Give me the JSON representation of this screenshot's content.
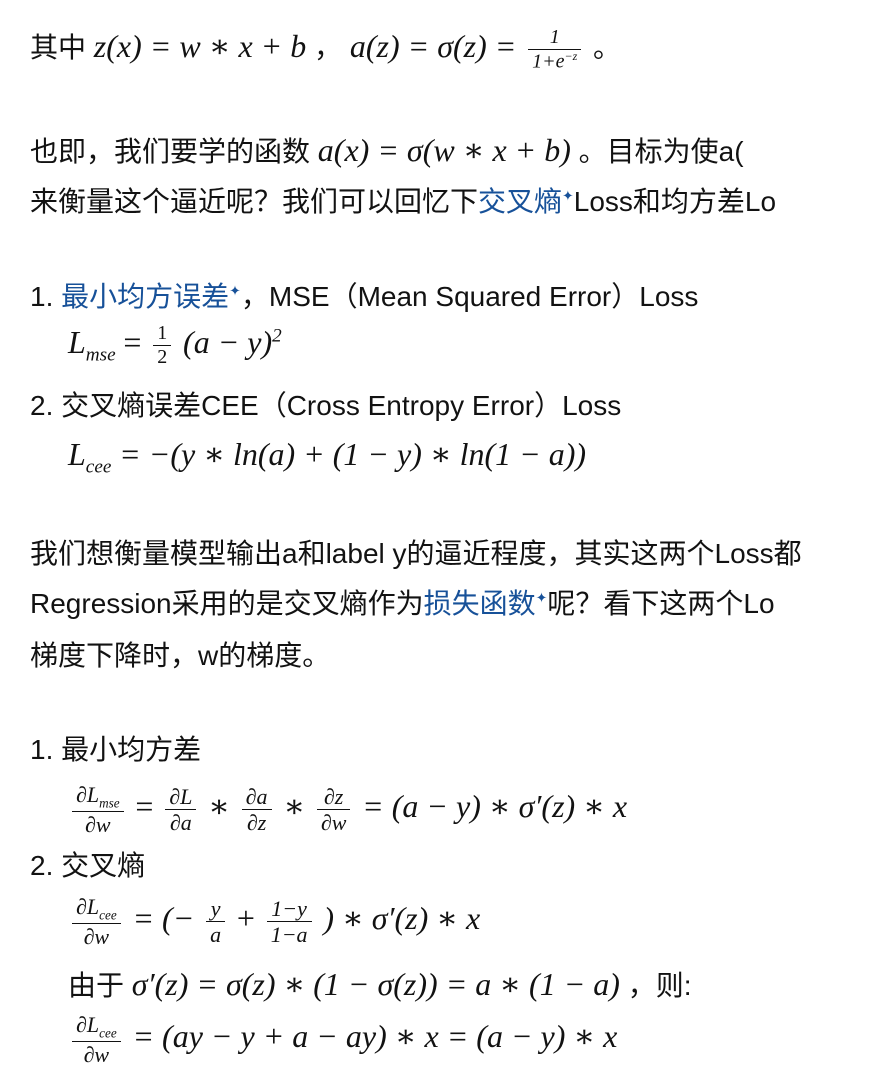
{
  "p1": {
    "prefix": "其中",
    "z_eq": "z(x) = w ∗ x + b",
    "sep": "，",
    "a_eq_lhs": "a(z) = σ(z) =",
    "frac_num": "1",
    "frac_den": "1+e",
    "frac_den_exp": "−z",
    "end": "。"
  },
  "p2": {
    "l1_prefix": "也即，我们要学的函数",
    "l1_math": "a(x) = σ(w ∗ x + b)",
    "l1_suffix": "。目标为使a(",
    "l2_prefix": "来衡量这个逼近呢？我们可以回忆下",
    "l2_link": "交叉熵",
    "l2_suffix": "Loss和均方差Lo"
  },
  "list1": {
    "item1_num": "1.",
    "item1_link": "最小均方误差",
    "item1_text": "，MSE（Mean Squared Error）Loss",
    "item1_formula_lhs": "L",
    "item1_formula_sub": "mse",
    "item1_formula_eq": "=",
    "item1_frac_num": "1",
    "item1_frac_den": "2",
    "item1_formula_rhs": "(a − y)",
    "item1_formula_pow": "2",
    "item2_num": "2.",
    "item2_text": "交叉熵误差CEE（Cross Entropy Error）Loss",
    "item2_formula_lhs": "L",
    "item2_formula_sub": "cee",
    "item2_formula_rhs": "= −(y ∗ ln(a) + (1 − y) ∗ ln(1 − a))"
  },
  "p3": {
    "l1": "我们想衡量模型输出a和label y的逼近程度，其实这两个Loss都",
    "l2_prefix": "Regression采用的是交叉熵作为",
    "l2_link": "损失函数",
    "l2_suffix": "呢？看下这两个Lo",
    "l3": "梯度下降时，w的梯度。"
  },
  "list2": {
    "item1_num": "1.",
    "item1_text": "最小均方差",
    "f1_lhs_num": "∂L",
    "f1_lhs_num_sub": "mse",
    "f1_lhs_den": "∂w",
    "f1_eq": "=",
    "f1_a_num": "∂L",
    "f1_a_den": "∂a",
    "f1_b_num": "∂a",
    "f1_b_den": "∂z",
    "f1_c_num": "∂z",
    "f1_c_den": "∂w",
    "f1_rhs": "= (a − y) ∗ σ′(z) ∗ x",
    "item2_num": "2.",
    "item2_text": "交叉熵",
    "f2_lhs_num": "∂L",
    "f2_lhs_num_sub": "cee",
    "f2_lhs_den": "∂w",
    "f2_eq": "= (−",
    "f2_y_num": "y",
    "f2_y_den": "a",
    "f2_plus": "+",
    "f2_b_num": "1−y",
    "f2_b_den": "1−a",
    "f2_rhs": ") ∗ σ′(z) ∗ x",
    "since_prefix": "由于",
    "since_math": "σ′(z) = σ(z) ∗ (1 − σ(z)) = a ∗ (1 − a)",
    "since_suffix": "，则:",
    "f3_lhs_num": "∂L",
    "f3_lhs_num_sub": "cee",
    "f3_lhs_den": "∂w",
    "f3_rhs": "= (ay − y + a − ay) ∗ x = (a − y) ∗ x"
  }
}
